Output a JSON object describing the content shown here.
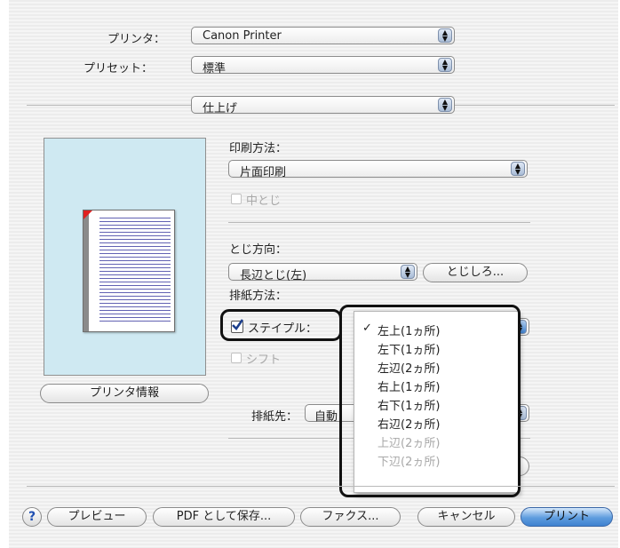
{
  "printer": {
    "label": "プリンタ：",
    "value": "Canon Printer"
  },
  "preset": {
    "label": "プリセット：",
    "value": "標準"
  },
  "panel": {
    "value": "仕上げ"
  },
  "print_method": {
    "label": "印刷方法：",
    "value": "片面印刷",
    "saddle_label": "中とじ"
  },
  "binding": {
    "label": "とじ方向：",
    "value": "長辺とじ(左)",
    "margin_button": "とじしろ..."
  },
  "output_method": {
    "label": "排紙方法：",
    "staple_label": "ステイプル：",
    "shift_label": "シフト"
  },
  "staple_menu": {
    "items": [
      {
        "label": "左上(1ヵ所)",
        "checked": true,
        "enabled": true
      },
      {
        "label": "左下(1ヵ所)",
        "checked": false,
        "enabled": true
      },
      {
        "label": "左辺(2ヵ所)",
        "checked": false,
        "enabled": true
      },
      {
        "label": "右上(1ヵ所)",
        "checked": false,
        "enabled": true
      },
      {
        "label": "右下(1ヵ所)",
        "checked": false,
        "enabled": true
      },
      {
        "label": "右辺(2ヵ所)",
        "checked": false,
        "enabled": true
      },
      {
        "label": "上辺(2ヵ所)",
        "checked": false,
        "enabled": false
      },
      {
        "label": "下辺(2ヵ所)",
        "checked": false,
        "enabled": false
      }
    ]
  },
  "output_dest": {
    "label": "排紙先：",
    "value": "自動"
  },
  "printer_info_button": "プリンタ情報",
  "footer": {
    "help": "?",
    "preview": "プレビュー",
    "save_pdf": "PDF として保存...",
    "fax": "ファクス...",
    "cancel": "キャンセル",
    "print": "プリント"
  }
}
